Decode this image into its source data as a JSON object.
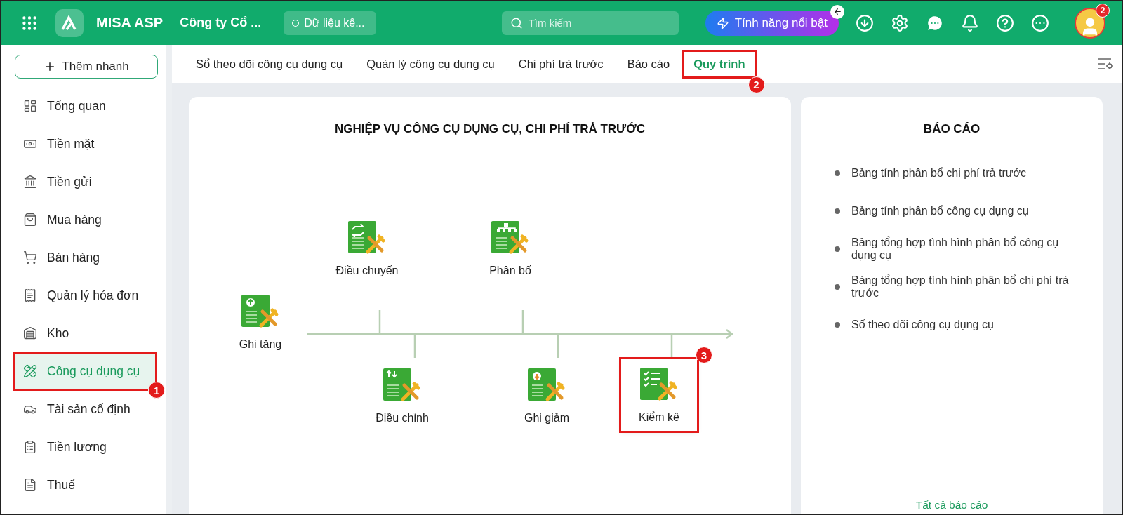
{
  "header": {
    "app_name": "MISA ASP",
    "company": "Công ty Cổ ...",
    "data_status": "Dữ liệu kế...",
    "search": {
      "placeholder": "Tìm kiếm"
    },
    "feature_button": "Tính năng nổi bật",
    "avatar_badge": "2"
  },
  "sidebar": {
    "quick_add": "Thêm nhanh",
    "items": [
      {
        "label": "Tổng quan",
        "selected": false
      },
      {
        "label": "Tiền mặt",
        "selected": false
      },
      {
        "label": "Tiền gửi",
        "selected": false
      },
      {
        "label": "Mua hàng",
        "selected": false
      },
      {
        "label": "Bán hàng",
        "selected": false
      },
      {
        "label": "Quản lý hóa đơn",
        "selected": false
      },
      {
        "label": "Kho",
        "selected": false
      },
      {
        "label": "Công cụ dụng cụ",
        "selected": true,
        "callout": "1"
      },
      {
        "label": "Tài sản cố định",
        "selected": false
      },
      {
        "label": "Tiền lương",
        "selected": false
      },
      {
        "label": "Thuế",
        "selected": false
      }
    ]
  },
  "tabs": [
    {
      "label": "Sổ theo dõi công cụ dụng cụ",
      "selected": false
    },
    {
      "label": "Quản lý công cụ dụng cụ",
      "selected": false
    },
    {
      "label": "Chi phí trả trước",
      "selected": false
    },
    {
      "label": "Báo cáo",
      "selected": false
    },
    {
      "label": "Quy trình",
      "selected": true,
      "callout": "2"
    }
  ],
  "process": {
    "title": "NGHIỆP VỤ CÔNG CỤ DỤNG CỤ, CHI PHÍ TRẢ TRƯỚC",
    "nodes": [
      {
        "label": "Ghi tăng"
      },
      {
        "label": "Điều chuyển"
      },
      {
        "label": "Phân bổ"
      },
      {
        "label": "Điều chỉnh"
      },
      {
        "label": "Ghi giảm"
      },
      {
        "label": "Kiểm kê",
        "callout": "3"
      }
    ]
  },
  "reports": {
    "title": "BÁO CÁO",
    "items": [
      "Bảng tính phân bổ chi phí trả trước",
      "Bảng tính phân bổ công cụ dụng cụ",
      "Bảng tổng hợp tình hình phân bổ công cụ dụng cụ",
      "Bảng tổng hợp tình hình phân bổ chi phí trả trước",
      "Sổ theo dõi công cụ dụng cụ"
    ],
    "all_link": "Tất cả báo cáo"
  }
}
